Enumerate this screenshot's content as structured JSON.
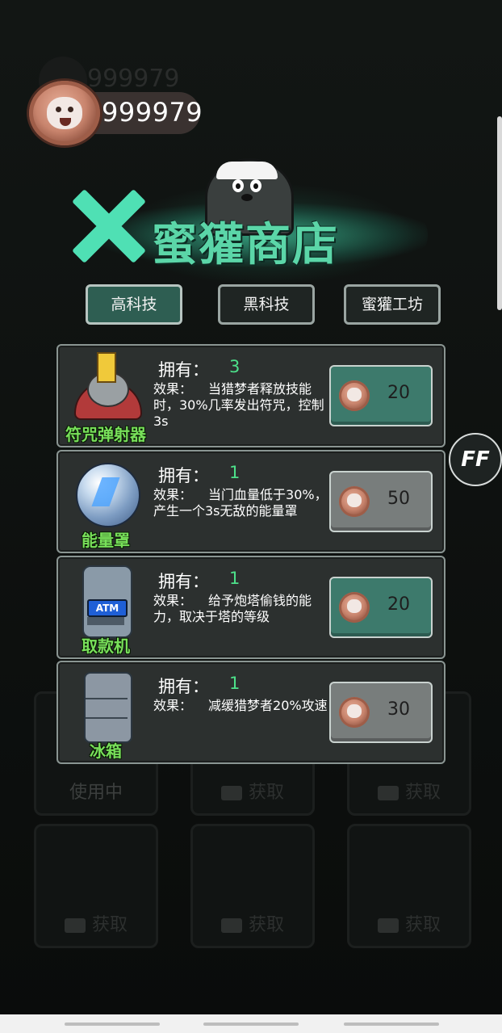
{
  "header": {
    "coins": "999979",
    "coins_ghost": "999979"
  },
  "shop": {
    "title": "蜜獾商店",
    "tabs": [
      {
        "label": "高科技",
        "active": true
      },
      {
        "label": "黑科技",
        "active": false
      },
      {
        "label": "蜜獾工坊",
        "active": false
      }
    ],
    "own_label": "拥有：",
    "effect_label": "效果：",
    "items": [
      {
        "name": "符咒弹射器",
        "owned": "3",
        "effect": "当猎梦者释放技能时，30%几率发出符咒，控制3s",
        "price": "20",
        "icon": "talisman-launcher-icon",
        "button_color": "#3d7a6c"
      },
      {
        "name": "能量罩",
        "owned": "1",
        "effect": "当门血量低于30%，产生一个3s无敌的能量罩",
        "price": "50",
        "icon": "energy-shield-icon",
        "button_color": "#787d7c"
      },
      {
        "name": "取款机",
        "owned": "1",
        "effect": "给予炮塔偷钱的能力，取决于塔的等级",
        "price": "20",
        "icon": "atm-icon",
        "button_color": "#3d7a6c",
        "icon_text": "ATM"
      },
      {
        "name": "冰箱",
        "owned": "1",
        "effect": "减缓猎梦者20%攻速",
        "price": "30",
        "icon": "fridge-icon",
        "button_color": "#787d7c"
      }
    ]
  },
  "background_cards": {
    "in_use_label": "使用中",
    "get_label": "获取"
  },
  "fast_forward": {
    "label": "FF"
  },
  "colors": {
    "accent": "#5bd6a8",
    "owned_value": "#4de08a",
    "item_name": "#78e05a",
    "teal_button": "#3d7a6c",
    "grey_button": "#787d7c"
  }
}
